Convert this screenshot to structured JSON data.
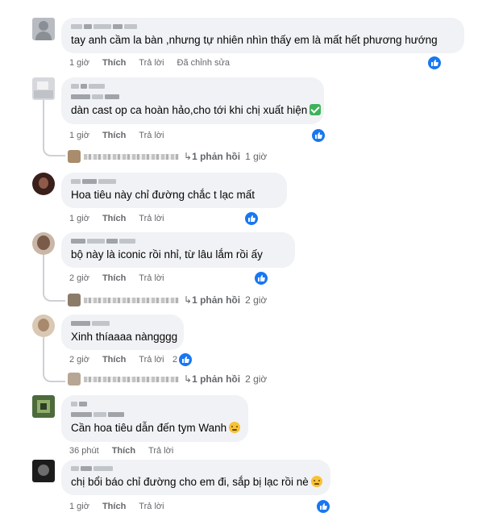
{
  "labels": {
    "like": "Thích",
    "reply": "Trả lời",
    "edited": "Đã chỉnh sửa",
    "replies_suffix": "phản hồi"
  },
  "colors": {
    "bubble": "#f0f2f5",
    "meta": "#65676b",
    "like_blue": "#1877f2"
  },
  "comments": [
    {
      "text": "tay anh cầm la bàn ,nhưng tự nhiên nhìn thấy em là mất hết phương hướng",
      "time": "1 giờ",
      "edited": true,
      "like_count": ""
    },
    {
      "text": "dàn cast op ca hoàn hảo,cho tới khi chị xuất hiện",
      "emoji": "check-emoji",
      "time": "1 giờ",
      "like_count": "",
      "replies": {
        "count": "1 phản hồi",
        "time": "1 giờ"
      }
    },
    {
      "text": "Hoa tiêu này chỉ đường chắc t lạc mất",
      "time": "1 giờ",
      "like_count": ""
    },
    {
      "text": "bộ này là iconic rồi nhỉ, từ lâu lắm rồi ấy",
      "time": "2 giờ",
      "like_count": "",
      "replies": {
        "count": "1 phản hồi",
        "time": "2 giờ"
      }
    },
    {
      "text": "Xinh thíaaaa nàngggg",
      "time": "2 giờ",
      "like_count": "2",
      "replies": {
        "count": "1 phản hồi",
        "time": "2 giờ"
      }
    },
    {
      "text": "Cần hoa tiêu dẫn đến tym Wanh",
      "emoji": "face-emoji",
      "time": "36 phút",
      "like_count": ""
    },
    {
      "text": "chị bổi báo chỉ đường cho em đi, sắp bị lạc rồi nè",
      "emoji": "face-emoji",
      "time": "1 giờ",
      "like_count": ""
    }
  ]
}
